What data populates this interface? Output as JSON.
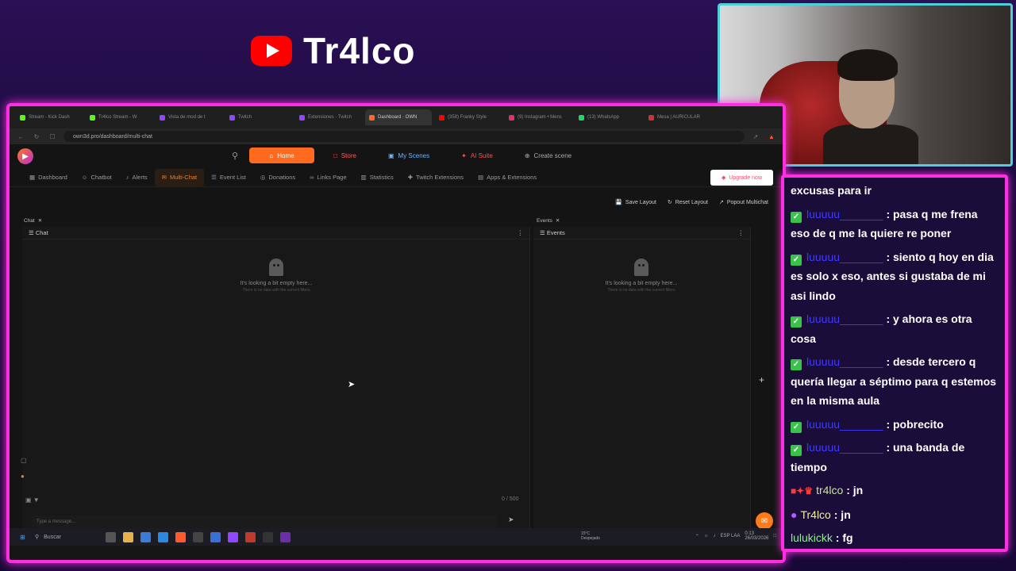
{
  "stream": {
    "channel_name": "Tr4lco"
  },
  "browser": {
    "tabs": [
      {
        "label": "Stream - Kick Dash",
        "color": "#53fc18"
      },
      {
        "label": "Tr4lco Stream - W",
        "color": "#53fc18"
      },
      {
        "label": "Vista de mod de t",
        "color": "#9146ff"
      },
      {
        "label": "Twitch",
        "color": "#9146ff"
      },
      {
        "label": "Extensiones · Twitch",
        "color": "#9146ff"
      },
      {
        "label": "Dashboard · OWN",
        "color": "#ff6a1f",
        "active": true
      },
      {
        "label": "(358) Franky Style",
        "color": "#ff0000"
      },
      {
        "label": "(9) Instagram • Mens",
        "color": "#e1306c"
      },
      {
        "label": "(13) WhatsApp",
        "color": "#25d366"
      },
      {
        "label": "Mesa | AURICULAR",
        "color": "#cc3333"
      }
    ],
    "url": "own3d.pro/dashboard/multi-chat"
  },
  "app": {
    "topnav": {
      "home": "Home",
      "store": "Store",
      "my_scenes": "My Scenes",
      "ai_suite": "AI Suite",
      "create_scene": "Create scene"
    },
    "subnav": [
      {
        "label": "Dashboard",
        "icon": "grid-icon"
      },
      {
        "label": "Chatbot",
        "icon": "bot-icon"
      },
      {
        "label": "Alerts",
        "icon": "bell-icon"
      },
      {
        "label": "Multi-Chat",
        "icon": "chat-icon",
        "active": true
      },
      {
        "label": "Event List",
        "icon": "list-icon"
      },
      {
        "label": "Donations",
        "icon": "coin-icon"
      },
      {
        "label": "Links Page",
        "icon": "link-icon"
      },
      {
        "label": "Statistics",
        "icon": "stats-icon"
      },
      {
        "label": "Twitch Extensions",
        "icon": "puzzle-icon"
      },
      {
        "label": "Apps & Extensions",
        "icon": "apps-icon"
      }
    ],
    "upgrade_label": "Upgrade now",
    "layout": {
      "save": "Save Layout",
      "reset": "Reset Layout",
      "popout": "Popout Multichat"
    },
    "chat_panel": {
      "tab": "Chat",
      "title": "Chat",
      "empty_title": "It's looking a bit empty here...",
      "empty_sub": "There is no data with the current filters",
      "counter": "0 / 500",
      "placeholder": "Type a message..."
    },
    "events_panel": {
      "tab": "Events",
      "title": "Events",
      "empty_title": "It's looking a bit empty here...",
      "empty_sub": "There is no data with the current filters"
    }
  },
  "taskbar": {
    "search": "Buscar",
    "weather_temp": "15°C",
    "weather_desc": "Despejado",
    "lang": "ESP LAA",
    "time": "0:13",
    "date": "26/03/2026"
  },
  "chat_overlay": {
    "messages": [
      {
        "user": "",
        "text": "excusas para ir",
        "badge": ""
      },
      {
        "user": "luuuuu_______",
        "text": ": pasa q me frena eso de q me la quiere re poner",
        "badge": "check"
      },
      {
        "user": "luuuuu_______",
        "text": ": siento q hoy en dia es solo x eso, antes si gustaba de mi asi lindo",
        "badge": "check"
      },
      {
        "user": "luuuuu_______",
        "text": ": y ahora es otra cosa",
        "badge": "check"
      },
      {
        "user": "luuuuu_______",
        "text": ": desde tercero q quería llegar a séptimo para q estemos en la misma aula",
        "badge": "check"
      },
      {
        "user": "luuuuu_______",
        "text": ": pobrecito",
        "badge": "check"
      },
      {
        "user": "luuuuu_______",
        "text": ": una banda de tiempo",
        "badge": "check"
      },
      {
        "user": "tr4lco",
        "text": ": jn",
        "badge": "broadcaster"
      },
      {
        "user": "Tr4lco",
        "text": ": jn",
        "badge": "mic"
      },
      {
        "user": "lulukickk",
        "text": ": fg",
        "badge": ""
      }
    ]
  }
}
